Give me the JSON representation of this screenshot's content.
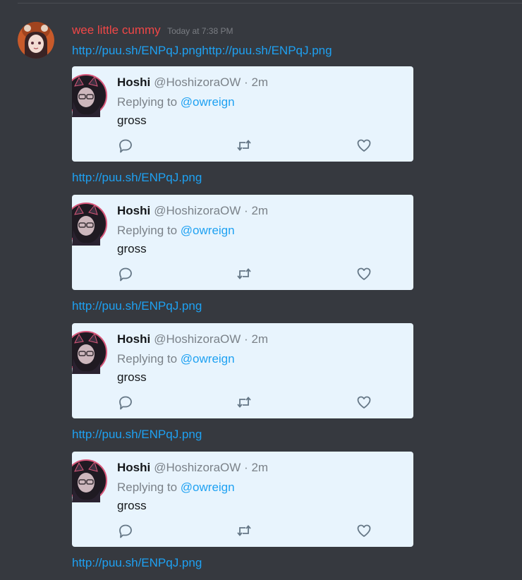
{
  "message": {
    "username": "wee little cummy",
    "timestamp": "Today at 7:38 PM",
    "first_link": "http://puu.sh/ENPqJ.pnghttp://puu.sh/ENPqJ.png",
    "link": "http://puu.sh/ENPqJ.png"
  },
  "tweet": {
    "name": "Hoshi",
    "handle": "@HoshizoraOW",
    "separator": "·",
    "time": "2m",
    "replying_prefix": "Replying to",
    "replying_to": "@owreign",
    "text": "gross"
  },
  "colors": {
    "background": "#36393f",
    "username": "#f04747",
    "link": "#1ea1f2",
    "embed_bg": "#e8f4fd"
  },
  "icons": {
    "reply": "reply-icon",
    "retweet": "retweet-icon",
    "like": "heart-icon"
  }
}
